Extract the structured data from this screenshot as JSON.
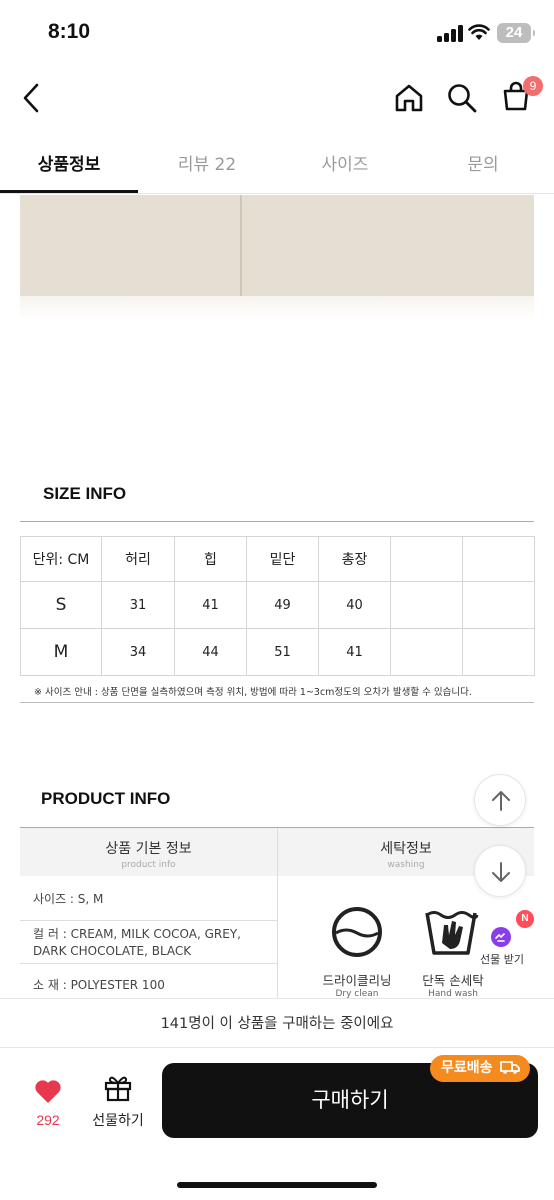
{
  "status_bar": {
    "time": "8:10",
    "battery": "24"
  },
  "nav": {
    "cart_count": "9"
  },
  "tabs": [
    {
      "label": "상품정보"
    },
    {
      "label": "리뷰 22"
    },
    {
      "label": "사이즈"
    },
    {
      "label": "문의"
    }
  ],
  "size_info": {
    "title": "SIZE INFO",
    "unit": "단위: CM",
    "columns": [
      "허리",
      "힙",
      "밑단",
      "총장",
      "",
      ""
    ],
    "rows": [
      {
        "label": "S",
        "values": [
          "31",
          "41",
          "49",
          "40",
          "",
          ""
        ]
      },
      {
        "label": "M",
        "values": [
          "34",
          "44",
          "51",
          "41",
          "",
          ""
        ]
      }
    ],
    "note": "※ 사이즈 안내 : 상품 단면을 실측하였으며 측정 위치, 방법에 따라 1~3cm정도의 오차가 발생할 수 있습니다."
  },
  "product_info": {
    "title": "PRODUCT INFO",
    "basic_header": "상품 기본 정보",
    "basic_header_en": "product info",
    "wash_header": "세탁정보",
    "wash_header_en": "washing",
    "rows": [
      {
        "text": "사이즈 : S, M"
      },
      {
        "text": "컬 러 : CREAM, MILK COCOA, GREY, DARK CHOCOLATE, BLACK"
      },
      {
        "text": "소 재 : POLYESTER 100"
      }
    ],
    "wash": [
      {
        "label": "드라이클리닝",
        "label_en": "Dry clean",
        "icon": "dry-clean-icon"
      },
      {
        "label": "단독 손세탁",
        "label_en": "Hand wash",
        "icon": "hand-wash-icon"
      }
    ]
  },
  "floating": {
    "gift_label": "선물 받기",
    "new_badge": "N"
  },
  "buy_strip": "141명이 이 상품을 구매하는 중이에요",
  "bottom_bar": {
    "like_count": "292",
    "gift_label": "선물하기",
    "buy_label": "구매하기",
    "free_shipping": "무료배송"
  },
  "colors": {
    "accent_orange": "#f58a1f",
    "like_red": "#e8384f",
    "badge_red": "#f26d6d"
  }
}
